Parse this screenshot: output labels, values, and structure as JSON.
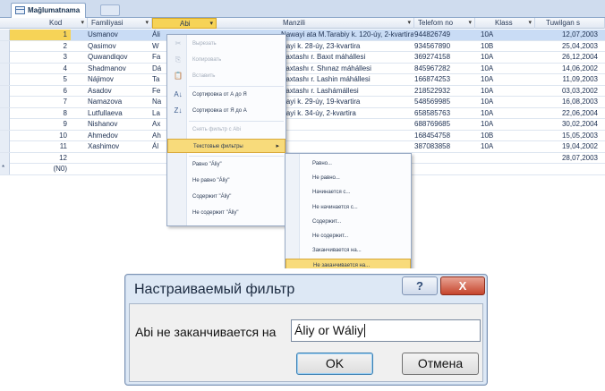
{
  "tab": {
    "title": "Ma&#287;lumatnama"
  },
  "columns": [
    {
      "label": "Kod"
    },
    {
      "label": "Familiyasi"
    },
    {
      "label": "Abi"
    },
    {
      "label": "Manzili"
    },
    {
      "label": "Telefom no"
    },
    {
      "label": "Klass"
    },
    {
      "label": "Tuwilgan s"
    }
  ],
  "rows": [
    {
      "kod": "1",
      "fam": "Usmanov",
      "abi": "Áli",
      "man": "Nawayi ata M.Tarabiy k. 120-úy, 2-kvartira",
      "tel": "944826749",
      "kla": "10A",
      "tug": "12,07,2003",
      "selected": true
    },
    {
      "kod": "2",
      "fam": "Qasimov",
      "abi": "W",
      "man": "wayi k. 28-úy, 23-kvartira",
      "tel": "934567890",
      "kla": "10B",
      "tug": "25,04,2003"
    },
    {
      "kod": "3",
      "fam": "Quwandiqov",
      "abi": "Fa",
      "man": "Paxtashı r. Baxıt máhállesi",
      "tel": "369274158",
      "kla": "10A",
      "tug": "26,12,2004"
    },
    {
      "kod": "4",
      "fam": "Shadmanov",
      "abi": "Dá",
      "man": "Paxtashı r. Shınaz máhállesi",
      "tel": "845967282",
      "kla": "10A",
      "tug": "14,06,2002"
    },
    {
      "kod": "5",
      "fam": "Nájimov",
      "abi": "Ta",
      "man": "Paxtashı r. Lashin máhállesi",
      "tel": "166874253",
      "kla": "10A",
      "tug": "11,09,2003"
    },
    {
      "kod": "6",
      "fam": "Asadov",
      "abi": "Fe",
      "man": "Paxtashı r. Lashámállesi",
      "tel": "218522932",
      "kla": "10A",
      "tug": "03,03,2002"
    },
    {
      "kod": "7",
      "fam": "Namazova",
      "abi": "Na",
      "man": "wayi k. 29-úy, 19-kvartira",
      "tel": "548569985",
      "kla": "10A",
      "tug": "16,08,2003"
    },
    {
      "kod": "8",
      "fam": "Lutfullaeva",
      "abi": "La",
      "man": "wayi k. 34-úy, 2-kvartira",
      "tel": "658585763",
      "kla": "10A",
      "tug": "22,06,2004"
    },
    {
      "kod": "9",
      "fam": "Nishanov",
      "abi": "Ax",
      "man": "",
      "tel": "688769685",
      "kla": "10A",
      "tug": "30,02,2004"
    },
    {
      "kod": "10",
      "fam": "Ahmedov",
      "abi": "Ah",
      "man": "",
      "tel": "168454758",
      "kla": "10B",
      "tug": "15,05,2003"
    },
    {
      "kod": "11",
      "fam": "Xashimov",
      "abi": "Ál",
      "man": "",
      "tel": "387083858",
      "kla": "10A",
      "tug": "19,04,2002"
    },
    {
      "kod": "12",
      "fam": "",
      "abi": "",
      "man": "",
      "tel": "",
      "kla": "",
      "tug": "28,07,2003"
    },
    {
      "kod": "(N0)",
      "fam": "",
      "abi": "",
      "man": "",
      "tel": "",
      "kla": "",
      "tug": "",
      "new": true
    }
  ],
  "context_menu": [
    {
      "label": "Вырезать",
      "icon": "cut-icon",
      "glyph": "✂",
      "disabled": true
    },
    {
      "label": "Копировать",
      "icon": "copy-icon",
      "glyph": "⎘",
      "disabled": true
    },
    {
      "label": "Вставить",
      "icon": "paste-icon",
      "glyph": "📋",
      "disabled": true
    },
    {
      "label": "Сортировка от А до Я",
      "icon": "sort-az-icon",
      "glyph": "A↓",
      "disabled": false
    },
    {
      "label": "Сортировка от Я до А",
      "icon": "sort-za-icon",
      "glyph": "Z↓",
      "disabled": false
    },
    {
      "label": "Снять фильтр с Abi",
      "icon": "clear-filter-icon",
      "glyph": "",
      "disabled": true
    },
    {
      "label": "Текстовые фильтры",
      "icon": "",
      "glyph": "",
      "disabled": false,
      "highlighted": true,
      "has_submenu": true
    },
    {
      "label": "Равно \"Áliy\"",
      "icon": "",
      "glyph": "",
      "disabled": false
    },
    {
      "label": "Не равно \"Áliy\"",
      "icon": "",
      "glyph": "",
      "disabled": false
    },
    {
      "label": "Содержит \"Áliy\"",
      "icon": "",
      "glyph": "",
      "disabled": false
    },
    {
      "label": "Не содержит \"Áliy\"",
      "icon": "",
      "glyph": "",
      "disabled": false
    }
  ],
  "submenu": [
    {
      "label": "Равно..."
    },
    {
      "label": "Не равно..."
    },
    {
      "label": "Начинается с..."
    },
    {
      "label": "Не начинается с..."
    },
    {
      "label": "Содержит..."
    },
    {
      "label": "Не содержит..."
    },
    {
      "label": "Заканчивается на..."
    },
    {
      "label": "Не заканчивается на...",
      "highlighted": true
    }
  ],
  "dialog": {
    "title": "Настраиваемый фильтр",
    "help_label": "?",
    "close_label": "X",
    "field_label": "Abi не заканчивается на",
    "input_value": "Áliy or Wáliy",
    "ok_label": "OK",
    "cancel_label": "Отмена"
  }
}
